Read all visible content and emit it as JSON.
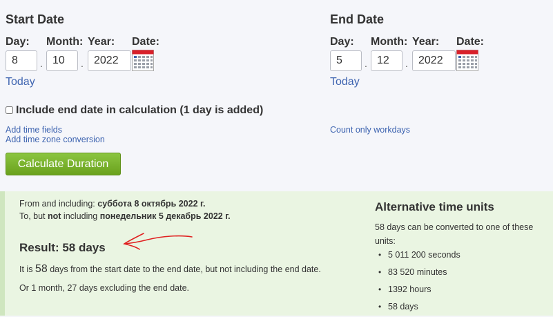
{
  "start": {
    "title": "Start Date",
    "labels": {
      "day": "Day:",
      "month": "Month:",
      "year": "Year:",
      "date": "Date:"
    },
    "day": "8",
    "month": "10",
    "year": "2022",
    "today": "Today"
  },
  "end": {
    "title": "End Date",
    "labels": {
      "day": "Day:",
      "month": "Month:",
      "year": "Year:",
      "date": "Date:"
    },
    "day": "5",
    "month": "12",
    "year": "2022",
    "today": "Today"
  },
  "separator": ".",
  "include_end": {
    "label": "Include end date in calculation (1 day is added)",
    "checked": false
  },
  "links": {
    "time_fields": "Add time fields",
    "time_zone": "Add time zone conversion",
    "workdays": "Count only workdays"
  },
  "calculate_button": "Calculate Duration",
  "result": {
    "from_prefix": "From and including: ",
    "from_date": "суббота 8 октябрь 2022 г.",
    "to_prefix_1": "To, but ",
    "to_not": "not",
    "to_prefix_2": " including ",
    "to_date": "понедельник 5 декабрь 2022 г.",
    "heading": "Result: 58 days",
    "sentence_pre": "It is ",
    "sentence_num": "58",
    "sentence_post": " days from the start date to the end date, but not including the end date.",
    "alt_sentence": "Or 1 month, 27 days excluding the end date."
  },
  "alt_units": {
    "title": "Alternative time units",
    "intro": "58 days can be converted to one of these units:",
    "items": [
      "5 011 200 seconds",
      "83 520 minutes",
      "1392 hours",
      "58 days"
    ]
  },
  "colors": {
    "link": "#3e64b0",
    "button": "#7cb52f",
    "result_bg": "#eaf5e2",
    "annotation_arrow": "#e02020",
    "calendar_header": "#d8202a"
  },
  "icons": {
    "calendar": "calendar-icon"
  }
}
